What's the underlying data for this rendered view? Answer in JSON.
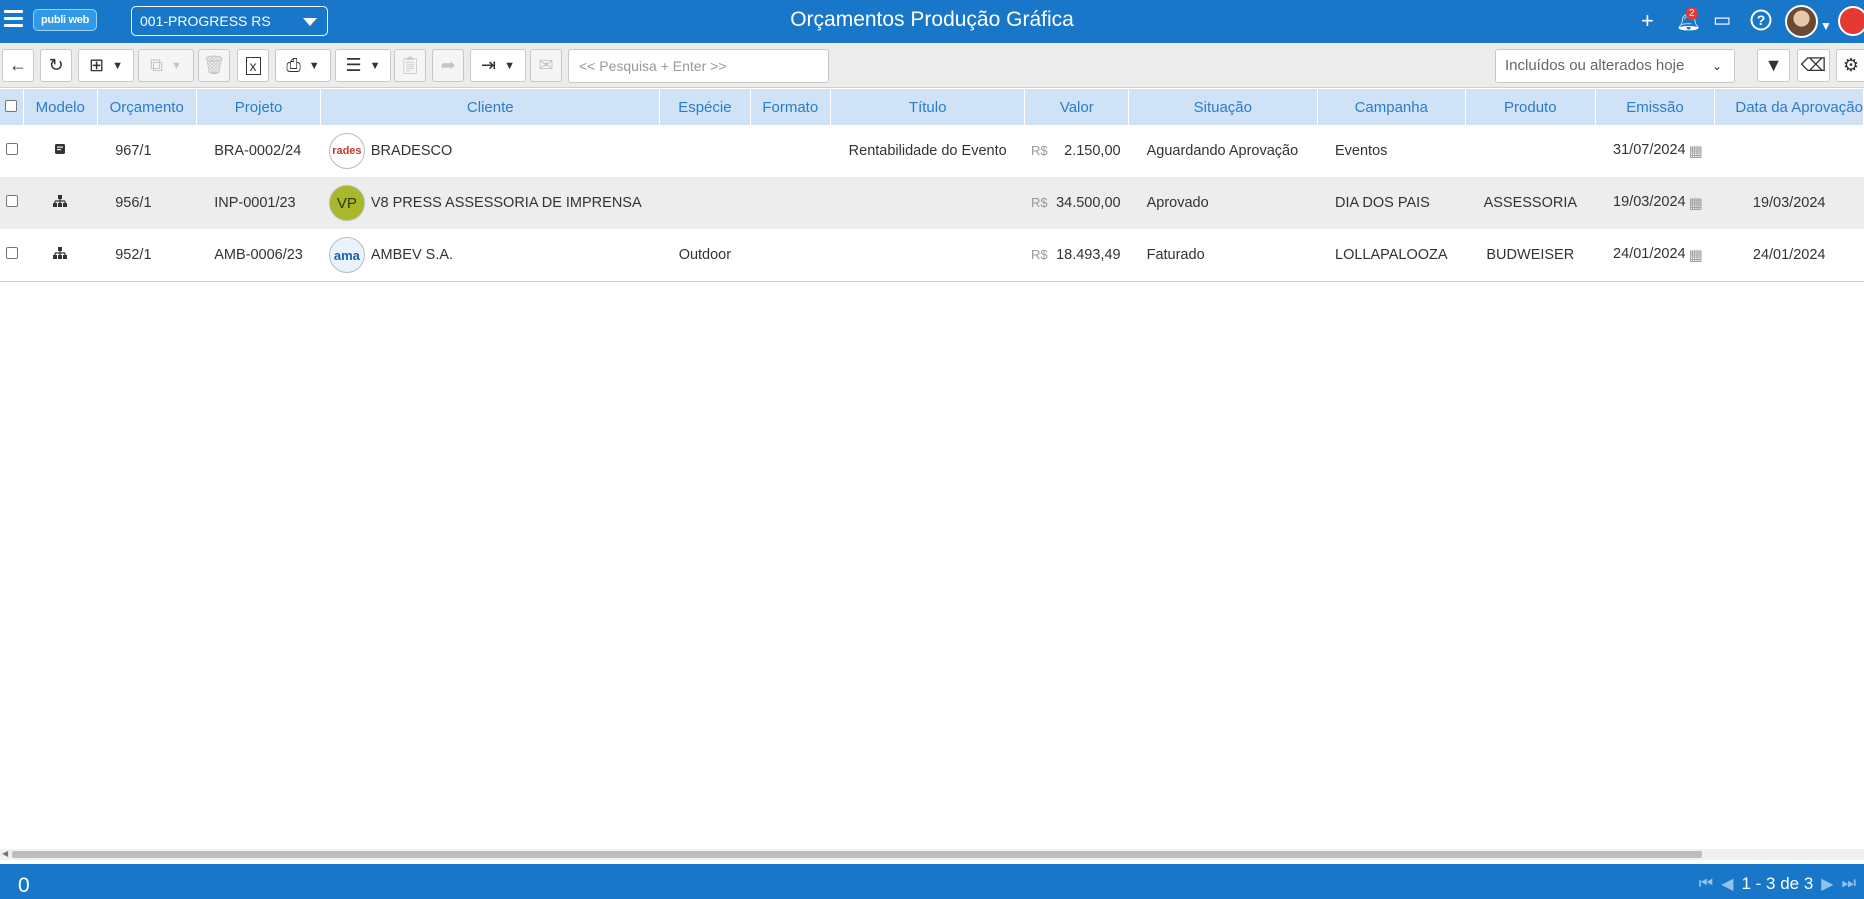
{
  "app": {
    "title": "Orçamentos Produção Gráfica",
    "logo": "publi web",
    "company": "001-PROGRESS RS",
    "notification_count": "2"
  },
  "toolbar": {
    "search_placeholder": "<< Pesquisa + Enter >>",
    "filter_value": "Incluídos ou alterados hoje",
    "buttons": [
      "back-icon",
      "refresh-icon",
      "add-icon",
      "copy-icon",
      "delete-icon",
      "excel-icon",
      "print-icon",
      "sort-icon",
      "clipboard-icon",
      "forward-icon",
      "export-icon",
      "mail-icon",
      "filter-icon",
      "eraser-icon",
      "gear-icon"
    ]
  },
  "table": {
    "columns": [
      "Modelo",
      "Orçamento",
      "Projeto",
      "Cliente",
      "Espécie",
      "Formato",
      "Título",
      "Valor",
      "Situação",
      "Campanha",
      "Produto",
      "Emissão",
      "Data da Aprovação"
    ],
    "currency": "R$",
    "rows": [
      {
        "modelo_icon": "document-icon",
        "orcamento": "967/1",
        "projeto": "BRA-0002/24",
        "cliente": "BRADESCO",
        "cliente_logo": "rades",
        "especie": "",
        "formato": "",
        "titulo": "Rentabilidade do Evento",
        "valor": "2.150,00",
        "situacao": "Aguardando Aprovação",
        "campanha": "Eventos",
        "produto": "",
        "emissao": "31/07/2024",
        "aprovacao": ""
      },
      {
        "modelo_icon": "hierarchy-icon",
        "orcamento": "956/1",
        "projeto": "INP-0001/23",
        "cliente": "V8 PRESS ASSESSORIA DE IMPRENSA",
        "cliente_logo": "VP",
        "especie": "",
        "formato": "",
        "titulo": "",
        "valor": "34.500,00",
        "situacao": "Aprovado",
        "campanha": "DIA DOS PAIS",
        "produto": "ASSESSORIA",
        "emissao": "19/03/2024",
        "aprovacao": "19/03/2024"
      },
      {
        "modelo_icon": "hierarchy-icon",
        "orcamento": "952/1",
        "projeto": "AMB-0006/23",
        "cliente": "AMBEV S.A.",
        "cliente_logo": "ama",
        "especie": "Outdoor",
        "formato": "",
        "titulo": "",
        "valor": "18.493,49",
        "situacao": "Faturado",
        "campanha": "LOLLAPALOOZA",
        "produto": "BUDWEISER",
        "emissao": "24/01/2024",
        "aprovacao": "24/01/2024"
      }
    ]
  },
  "footer": {
    "selected_count": "0",
    "pagination": "1 - 3 de 3"
  },
  "colors": {
    "primary": "#1877c9",
    "header_bg": "#cfe2f6",
    "header_text": "#2a7ccc"
  }
}
